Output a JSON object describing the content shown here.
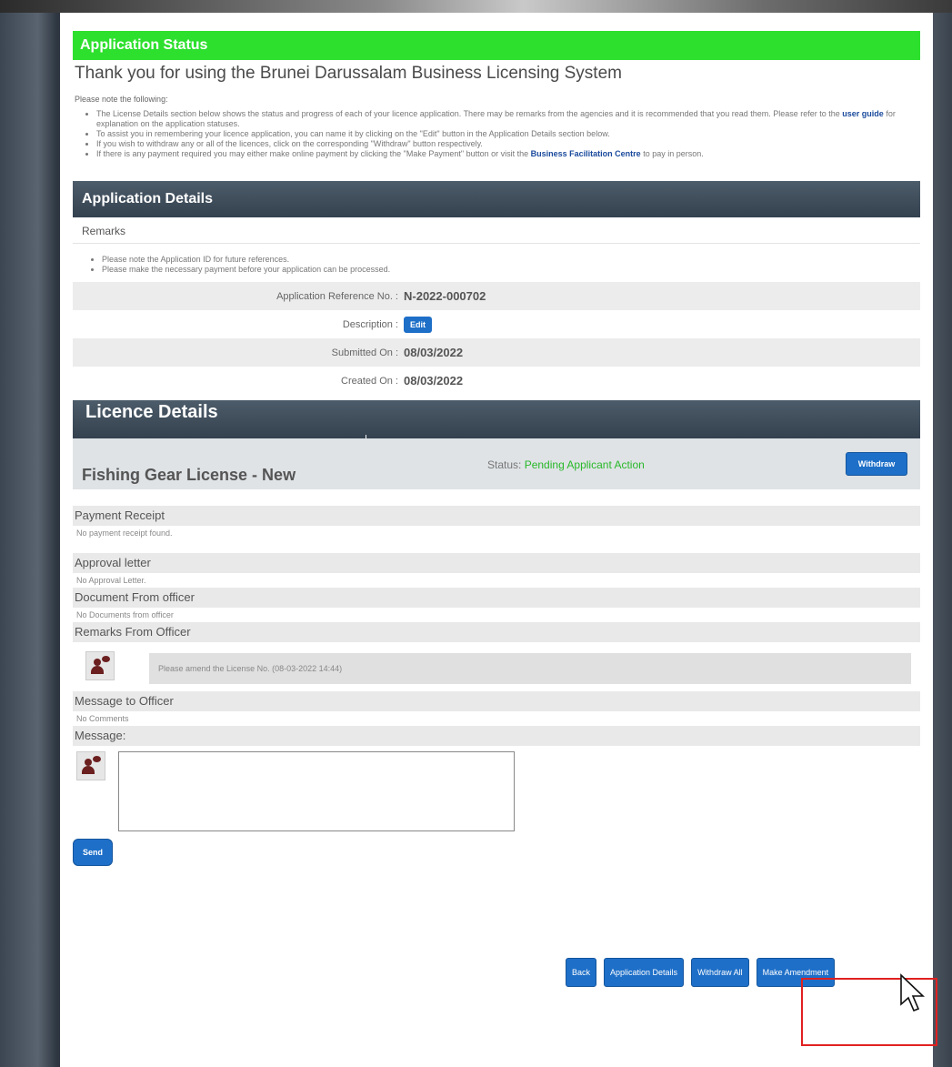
{
  "status": {
    "header": "Application Status",
    "thanks": "Thank you for using the Brunei Darussalam Business Licensing System",
    "note_intro": "Please note the following:",
    "bullet1_a": "The License Details section below shows the status and progress of each of your licence application. There may be remarks from the agencies and it is recommended that you read them. Please refer to the",
    "bullet1_link": "user guide",
    "bullet1_b": "for explanation on the application statuses.",
    "bullet2": "To assist you in remembering your licence application, you can name it by clicking on the \"Edit\" button in the Application Details section below.",
    "bullet3": "If you wish to withdraw any or all of the licences, click on the corresponding \"Withdraw\" button respectively.",
    "bullet4_a": "If there is any payment required you may either make online payment by clicking the \"Make Payment\" button or visit the",
    "bullet4_link": "Business Facilitation Centre",
    "bullet4_b": "to pay in person."
  },
  "app_details": {
    "header": "Application Details",
    "remarks_title": "Remarks",
    "remarks": [
      "Please note the Application ID for future references.",
      "Please make the necessary payment before your application can be processed."
    ],
    "ref_label": "Application Reference No. :",
    "ref_value": "N-2022-000702",
    "desc_label": "Description :",
    "edit_label": "Edit",
    "submitted_label": "Submitted On :",
    "submitted_value": "08/03/2022",
    "created_label": "Created On :",
    "created_value": "08/03/2022"
  },
  "licence": {
    "header": "Licence Details",
    "name": "Fishing Gear License - New",
    "status_label": "Status:",
    "status_value": "Pending Applicant Action",
    "withdraw_label": "Withdraw",
    "payment_title": "Payment Receipt",
    "payment_note": "No payment receipt found.",
    "approval_title": "Approval letter",
    "approval_note": "No Approval Letter.",
    "document_title": "Document From officer",
    "document_note": "No Documents from officer",
    "officer_remarks_title": "Remarks From Officer",
    "officer_remark": "Please amend the License No. (08-03-2022 14:44)",
    "message_officer_title": "Message to Officer",
    "message_officer_note": "No Comments",
    "message_label": "Message:",
    "send_label": "Send"
  },
  "footer_buttons": {
    "back": "Back",
    "app_details": "Application Details",
    "withdraw_all": "Withdraw All",
    "make_amendment": "Make Amendment"
  },
  "colors": {
    "status_green": "#2ee02e",
    "section_dark": "#3f4d5b",
    "button_blue": "#1e6fc8",
    "highlight_red": "#e02020"
  }
}
